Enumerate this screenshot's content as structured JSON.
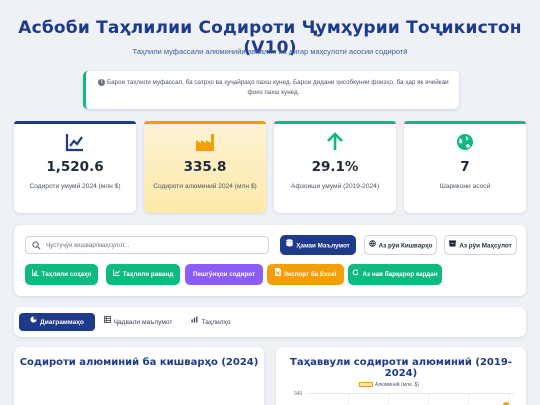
{
  "header": {
    "title": "Асбоби Таҳлилии Содироти Ҷумҳурии Тоҷикистон (V10)",
    "subtitle": "Таҳлили муфассали алюминийи аввалия ва дигар маҳсулоти асосии содиротӣ"
  },
  "notice": {
    "line1": "Барои таҳлили муфассал, ба сатрҳо ва ҳуҷайраҳо пахш кунед. Барои дидани ҳисобкунии фоизҳо, ба ҳар як ячейкаи",
    "line2": "фоиз пахш кунед."
  },
  "stats": [
    {
      "value": "1,520.6",
      "label": "Содироти умумӣ 2024 (млн $)",
      "icon": "line-chart-icon",
      "accent": "#1e3a8a"
    },
    {
      "value": "335.8",
      "label": "Содироти алюминий 2024 (млн $)",
      "icon": "factory-icon",
      "accent": "#f59e0b"
    },
    {
      "value": "29.1%",
      "label": "Афзоиши умумӣ (2019-2024)",
      "icon": "arrow-up-icon",
      "accent": "#10b981"
    },
    {
      "value": "7",
      "label": "Шарикони асосӣ",
      "icon": "globe-icon",
      "accent": "#10b981"
    }
  ],
  "search": {
    "placeholder": "Ҷустуҷӯи кишвар/маҳсулот..."
  },
  "filters": [
    {
      "label": "Ҳамаи Маълумот",
      "active": true
    },
    {
      "label": "Аз рӯи Кишварҳо",
      "active": false
    },
    {
      "label": "Аз рӯи Маҳсулот",
      "active": false
    }
  ],
  "actions": [
    {
      "label": "Таҳлили соҳаҳо",
      "color": "#10b981"
    },
    {
      "label": "Таҳлили раванд",
      "color": "#10b981"
    },
    {
      "label": "Пешгӯиҳои содирот",
      "color": "#8b5cf6"
    },
    {
      "label": "Экспорт ба Excel",
      "color": "#f59e0b"
    },
    {
      "label": "Аз нав барқарор кардан",
      "color": "#10b981"
    }
  ],
  "tabs": [
    {
      "label": "Диаграммаҳо",
      "active": true
    },
    {
      "label": "Ҷадвали маълумот",
      "active": false
    },
    {
      "label": "Таҳлилҳо",
      "active": false
    }
  ],
  "charts": {
    "left_title": "Содироти алюминий ба кишварҳо (2024)",
    "right_title": "Таҳаввули содироти алюминий (2019-2024)",
    "legend": "Алюминий (млн. $)",
    "ytick": "340",
    "accent": "#f59e0b"
  }
}
